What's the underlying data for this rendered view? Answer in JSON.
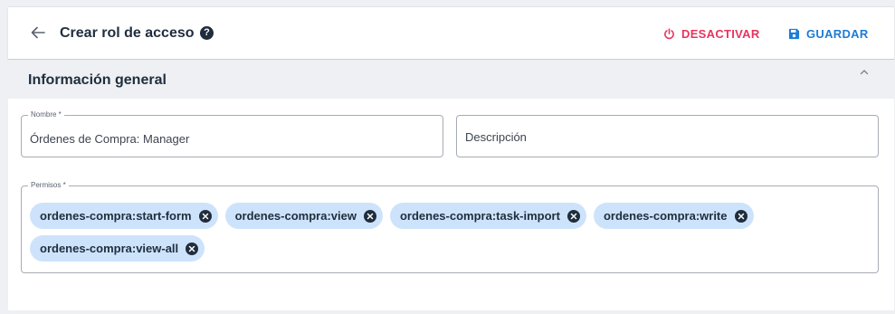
{
  "header": {
    "title": "Crear rol de acceso",
    "help_symbol": "?",
    "back_icon": "arrow-left-icon",
    "actions": {
      "deactivate_label": "DESACTIVAR",
      "deactivate_icon": "power-icon",
      "save_label": "GUARDAR",
      "save_icon": "floppy-disk-icon"
    }
  },
  "section": {
    "title": "Información general",
    "collapse_icon": "chevron-up-icon"
  },
  "form": {
    "name": {
      "label": "Nombre *",
      "value": "Órdenes de Compra: Manager"
    },
    "description": {
      "placeholder": "Descripción"
    },
    "permissions": {
      "label": "Permisos *",
      "chips": [
        "ordenes-compra:start-form",
        "ordenes-compra:view",
        "ordenes-compra:task-import",
        "ordenes-compra:write",
        "ordenes-compra:view-all"
      ]
    }
  },
  "colors": {
    "accent_danger": "#e8345f",
    "accent_primary": "#1d7cd6",
    "chip_background": "#cde3fb",
    "text_dark": "#1f2d3d",
    "section_background": "#eef0f3"
  }
}
